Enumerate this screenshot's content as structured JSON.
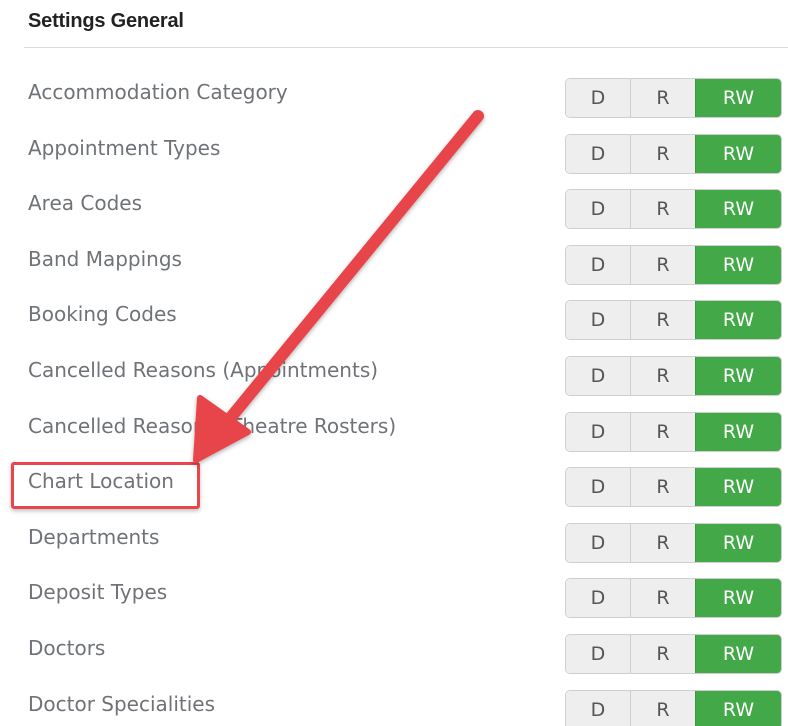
{
  "section": {
    "title": "Settings General"
  },
  "rows": [
    {
      "label": "Accommodation Category",
      "d": "D",
      "r": "R",
      "rw": "RW",
      "selected": "RW"
    },
    {
      "label": "Appointment Types",
      "d": "D",
      "r": "R",
      "rw": "RW",
      "selected": "RW"
    },
    {
      "label": "Area Codes",
      "d": "D",
      "r": "R",
      "rw": "RW",
      "selected": "RW"
    },
    {
      "label": "Band Mappings",
      "d": "D",
      "r": "R",
      "rw": "RW",
      "selected": "RW"
    },
    {
      "label": "Booking Codes",
      "d": "D",
      "r": "R",
      "rw": "RW",
      "selected": "RW"
    },
    {
      "label": "Cancelled Reasons (Appointments)",
      "d": "D",
      "r": "R",
      "rw": "RW",
      "selected": "RW"
    },
    {
      "label": "Cancelled Reasons (Theatre Rosters)",
      "d": "D",
      "r": "R",
      "rw": "RW",
      "selected": "RW"
    },
    {
      "label": "Chart Location",
      "d": "D",
      "r": "R",
      "rw": "RW",
      "selected": "RW"
    },
    {
      "label": "Departments",
      "d": "D",
      "r": "R",
      "rw": "RW",
      "selected": "RW"
    },
    {
      "label": "Deposit Types",
      "d": "D",
      "r": "R",
      "rw": "RW",
      "selected": "RW"
    },
    {
      "label": "Doctors",
      "d": "D",
      "r": "R",
      "rw": "RW",
      "selected": "RW"
    },
    {
      "label": "Doctor Specialities",
      "d": "D",
      "r": "R",
      "rw": "RW",
      "selected": "RW"
    }
  ],
  "annotation": {
    "highlighted_row": "Chart Location",
    "color": "#e8454c"
  },
  "colors": {
    "selected": "#43a948",
    "unselected": "#eeeeee",
    "label": "#6f7378"
  }
}
